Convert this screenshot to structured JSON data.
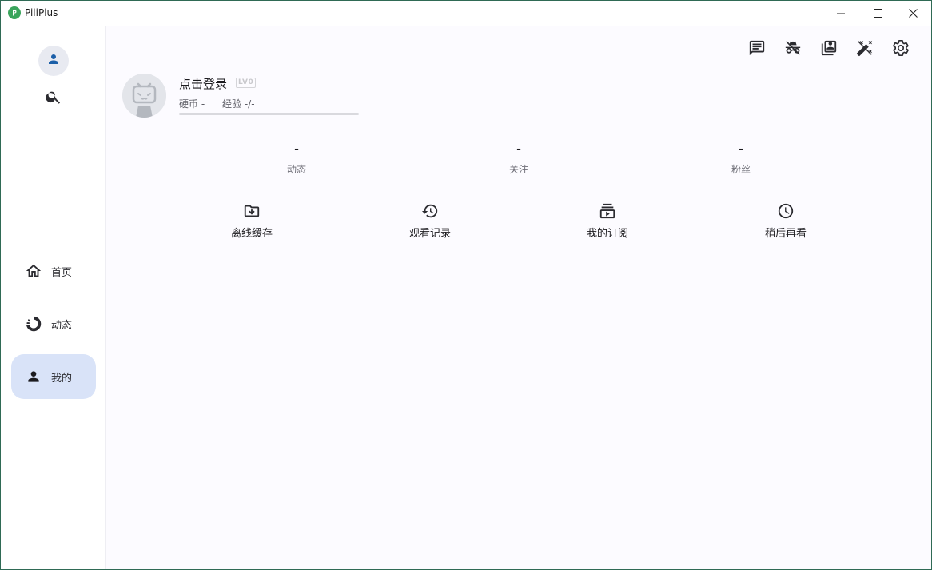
{
  "window": {
    "title": "PiliPlus"
  },
  "sidebar": {
    "items": [
      {
        "label": "首页",
        "icon": "home-icon",
        "active": false
      },
      {
        "label": "动态",
        "icon": "dynamic-icon",
        "active": false
      },
      {
        "label": "我的",
        "icon": "person-icon",
        "active": true
      }
    ]
  },
  "toolbar": {
    "icons": [
      "message-icon",
      "incognito-icon",
      "favorites-icon",
      "theme-icon",
      "settings-icon"
    ]
  },
  "profile": {
    "login_prompt": "点击登录",
    "level": "LV0",
    "coins": "硬币 -",
    "exp": "经验 -/-"
  },
  "stats": [
    {
      "value": "-",
      "label": "动态"
    },
    {
      "value": "-",
      "label": "关注"
    },
    {
      "value": "-",
      "label": "粉丝"
    }
  ],
  "quick_actions": [
    {
      "label": "离线缓存",
      "icon": "offline-download-icon"
    },
    {
      "label": "观看记录",
      "icon": "history-icon"
    },
    {
      "label": "我的订阅",
      "icon": "subscription-icon"
    },
    {
      "label": "稍后再看",
      "icon": "watch-later-icon"
    }
  ],
  "colors": {
    "accent": "#1b5fa8",
    "active_nav_bg": "#d9e3f8",
    "logo": "#3aa55c",
    "window_border": "#2f6a55"
  }
}
